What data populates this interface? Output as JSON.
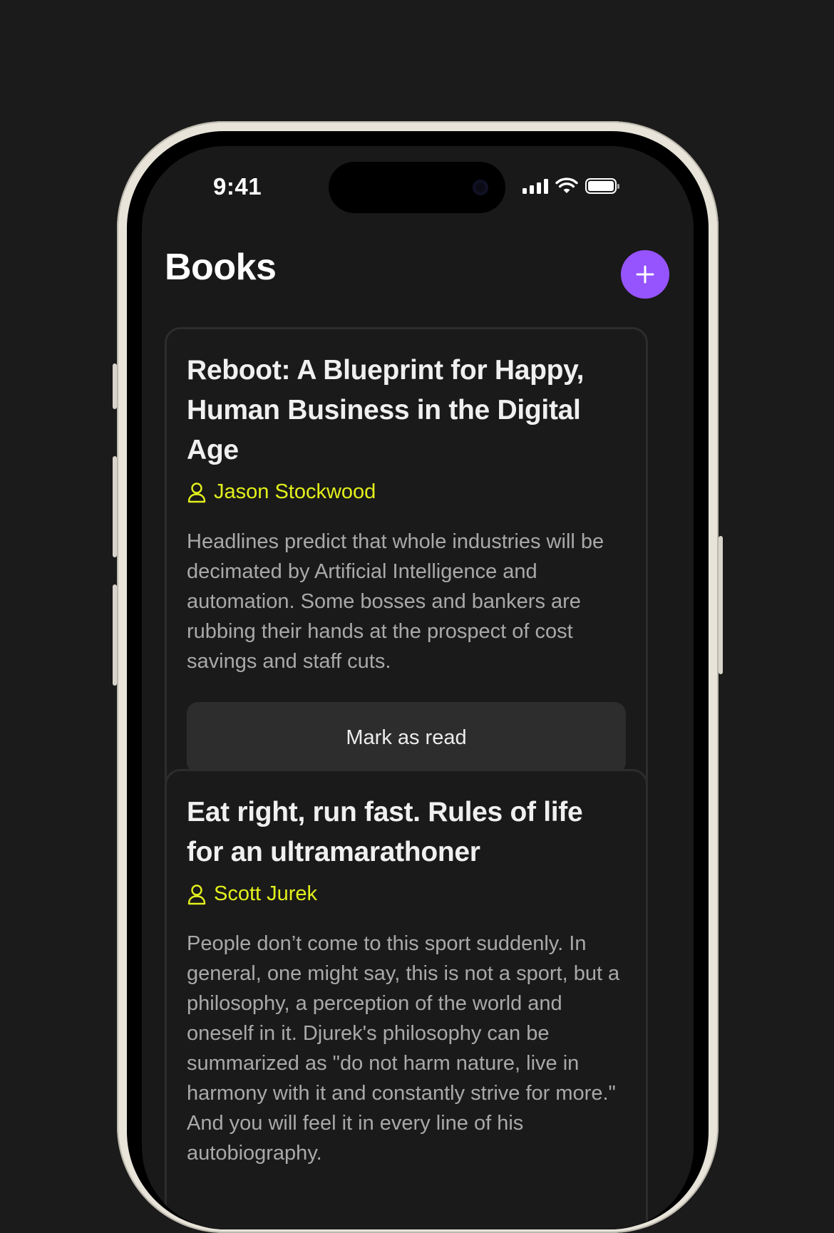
{
  "status_bar": {
    "time": "9:41"
  },
  "header": {
    "title": "Books"
  },
  "books": [
    {
      "title": "Reboot: A Blueprint for Happy, Human Business in the Digital Age",
      "author": "Jason Stockwood",
      "description": "Headlines predict that whole industries will be decimated by Artificial Intelligence and automation. Some bosses and bankers are rubbing their hands at the prospect of cost savings and staff cuts.",
      "action_label": "Mark as read"
    },
    {
      "title": "Eat right, run fast. Rules of life for an ultramarathoner",
      "author": "Scott Jurek",
      "description": "People don’t come to this sport suddenly. In general, one might say, this is not a sport, but a philosophy, a perception of the world and oneself in it. Djurek's philosophy can be summarized as \"do not harm nature, live in harmony with it and constantly strive for more.\" And you will feel it in every line of his autobiography."
    }
  ],
  "colors": {
    "accent": "#9654ff",
    "author": "#e3f01c",
    "background": "#191919",
    "card_border": "#2d2d2d",
    "button_bg": "#2d2d2d"
  },
  "icons": {
    "add": "plus-icon",
    "author": "user-icon",
    "signal": "cellular-signal-icon",
    "wifi": "wifi-icon",
    "battery": "battery-icon"
  }
}
